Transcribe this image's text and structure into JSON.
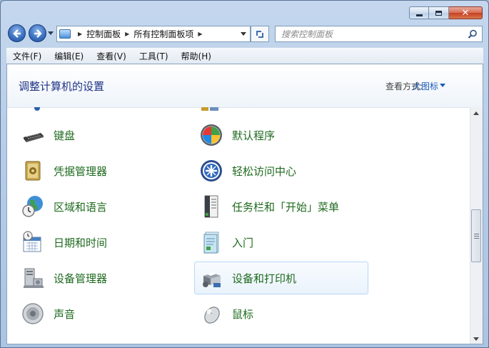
{
  "window": {
    "caption_buttons": [
      "minimize",
      "maximize",
      "close"
    ],
    "close_glyph": "✕"
  },
  "nav": {
    "breadcrumbs": [
      "控制面板",
      "所有控制面板项"
    ],
    "search_placeholder": "搜索控制面板"
  },
  "menu": [
    "文件(F)",
    "编辑(E)",
    "查看(V)",
    "工具(T)",
    "帮助(H)"
  ],
  "header": {
    "title": "调整计算机的设置",
    "view_by_label": "查看方式:",
    "view_by_value": "大图标"
  },
  "items": {
    "left": [
      {
        "label": "键盘",
        "icon": "keyboard-icon"
      },
      {
        "label": "凭据管理器",
        "icon": "credential-manager-icon"
      },
      {
        "label": "区域和语言",
        "icon": "region-language-icon"
      },
      {
        "label": "日期和时间",
        "icon": "date-time-icon"
      },
      {
        "label": "设备管理器",
        "icon": "device-manager-icon"
      },
      {
        "label": "声音",
        "icon": "sound-icon"
      }
    ],
    "right": [
      {
        "label": "默认程序",
        "icon": "default-programs-icon"
      },
      {
        "label": "轻松访问中心",
        "icon": "ease-of-access-icon"
      },
      {
        "label": "任务栏和「开始」菜单",
        "icon": "taskbar-start-menu-icon"
      },
      {
        "label": "入门",
        "icon": "getting-started-icon"
      },
      {
        "label": "设备和打印机",
        "icon": "devices-printers-icon"
      },
      {
        "label": "鼠标",
        "icon": "mouse-icon"
      }
    ],
    "hovered": "设备和打印机"
  },
  "colors": {
    "item_text": "#1e6a1e",
    "title_text": "#1e3287",
    "link_blue": "#1c5ab7"
  }
}
